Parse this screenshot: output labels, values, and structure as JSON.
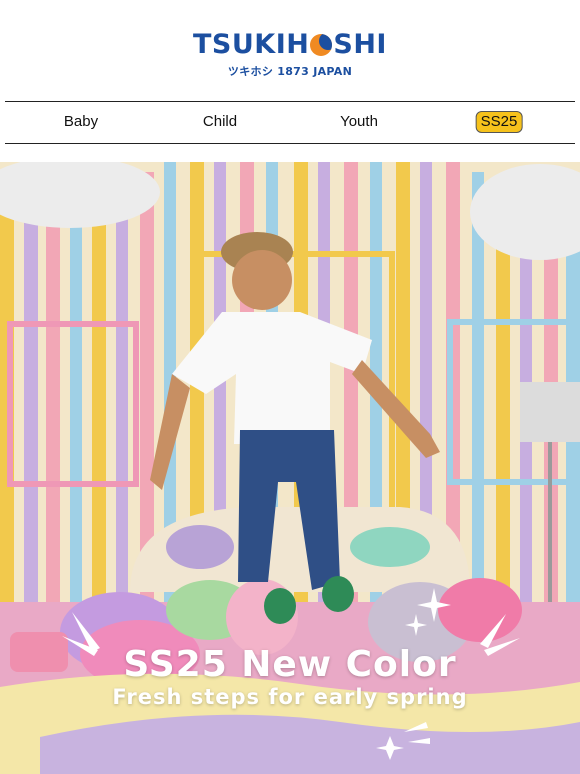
{
  "brand": {
    "name_left": "TSUKIH",
    "name_right": "SHI",
    "tagline": "ツキホシ 1873 JAPAN",
    "colors": {
      "primary": "#1c4fa0",
      "accent": "#f08a22"
    }
  },
  "nav": {
    "items": [
      {
        "label": "Baby"
      },
      {
        "label": "Child"
      },
      {
        "label": "Youth"
      },
      {
        "label": "SS25",
        "highlight": "#f6c21c"
      }
    ]
  },
  "hero": {
    "title": "SS25 New Color",
    "subtitle": "Fresh steps for early spring",
    "image_icon": "child-jumping-photo-icon"
  }
}
